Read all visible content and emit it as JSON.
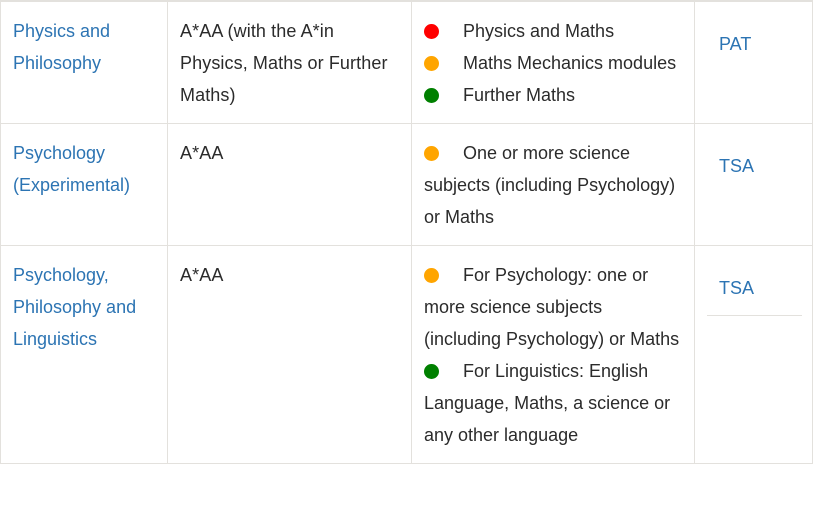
{
  "table": {
    "colors": {
      "link": "#2c74b3",
      "border": "#e3e1dd",
      "text": "#2b2b2b",
      "bullet_red": "#ff0000",
      "bullet_orange": "#ffa500",
      "bullet_green": "#008000"
    },
    "rows": [
      {
        "course": "Physics and Philosophy",
        "grades": "A*AA (with the A*in Physics, Maths or Further Maths)",
        "requirements": [
          {
            "color": "#ff0000",
            "color_name": "red",
            "text": "Physics and Maths"
          },
          {
            "color": "#ffa500",
            "color_name": "orange",
            "text": "Maths Mechanics modules"
          },
          {
            "color": "#008000",
            "color_name": "green",
            "text": "Further Maths"
          }
        ],
        "test": "PAT",
        "test_split": false
      },
      {
        "course": "Psychology (Experimental)",
        "grades": "A*AA",
        "requirements": [
          {
            "color": "#ffa500",
            "color_name": "orange",
            "text": "One or more science subjects (including Psychology) or Maths"
          }
        ],
        "test": "TSA",
        "test_split": false
      },
      {
        "course": "Psychology, Philosophy and Linguistics",
        "grades": "A*AA",
        "requirements": [
          {
            "color": "#ffa500",
            "color_name": "orange",
            "text": "For Psychology: one or more science subjects (including Psychology) or Maths"
          },
          {
            "color": "#008000",
            "color_name": "green",
            "text": "For Linguistics: English Language, Maths, a science or any other language"
          }
        ],
        "test": "TSA",
        "test_split": true
      }
    ]
  }
}
